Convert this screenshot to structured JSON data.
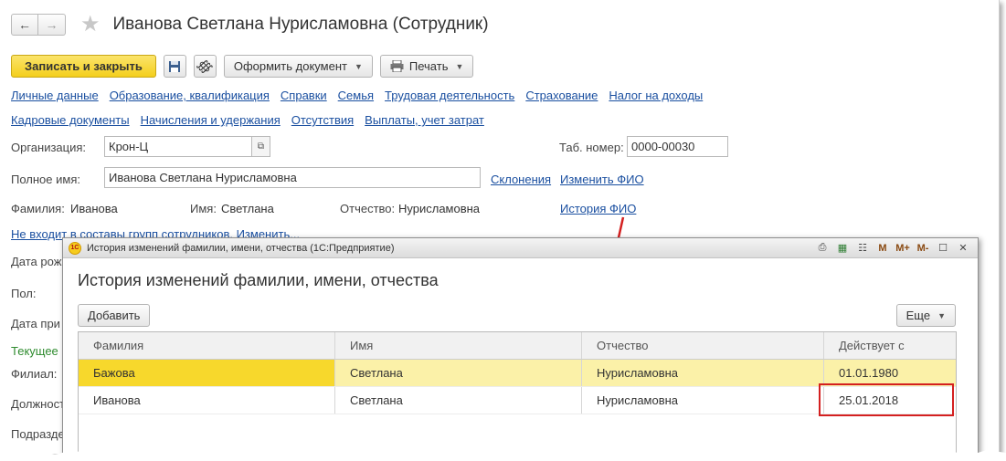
{
  "window": {
    "title": "Иванова Светлана Нурисламовна (Сотрудник)"
  },
  "toolbar": {
    "save_close": "Записать и закрыть",
    "make_doc": "Оформить документ",
    "print": "Печать"
  },
  "links_row1": [
    "Личные данные",
    "Образование, квалификация",
    "Справки",
    "Семья",
    "Трудовая деятельность",
    "Страхование",
    "Налог на доходы"
  ],
  "links_row2": [
    "Кадровые документы",
    "Начисления и удержания",
    "Отсутствия",
    "Выплаты, учет затрат"
  ],
  "form": {
    "org_label": "Организация:",
    "org_value": "Крон-Ц",
    "tab_label": "Таб. номер:",
    "tab_value": "0000-00030",
    "fullname_label": "Полное имя:",
    "fullname_value": "Иванова Светлана Нурисламовна",
    "declensions": "Склонения",
    "change_fio": "Изменить ФИО",
    "surname_label": "Фамилия:",
    "surname_value": "Иванова",
    "name_label": "Имя:",
    "name_value": "Светлана",
    "patronymic_label": "Отчество:",
    "patronymic_value": "Нурисламовна",
    "fio_history": "История ФИО",
    "groups_link": "Не входит в составы групп сотрудников. Изменить...",
    "birth_label": "Дата рож",
    "gender_label": "Пол:",
    "hire_label": "Дата при",
    "current_label": "Текущее",
    "branch_label": "Филиал:",
    "position_label": "Должност",
    "dept_label": "Подразде"
  },
  "dialog": {
    "window_title": "История изменений фамилии, имени, отчества  (1С:Предприятие)",
    "heading": "История изменений фамилии, имени, отчества",
    "add_button": "Добавить",
    "more_button": "Еще",
    "columns": [
      "Фамилия",
      "Имя",
      "Отчество",
      "Действует с"
    ],
    "rows": [
      [
        "Бажова",
        "Светлана",
        "Нурисламовна",
        "01.01.1980"
      ],
      [
        "Иванова",
        "Светлана",
        "Нурисламовна",
        "25.01.2018"
      ]
    ],
    "tools": [
      "M",
      "M+",
      "M-"
    ]
  },
  "colors": {
    "accent_yellow": "#f4cf1c",
    "link_blue": "#1a4fa0",
    "highlight_red": "#d42020",
    "selected_row": "#fbf1a8"
  }
}
